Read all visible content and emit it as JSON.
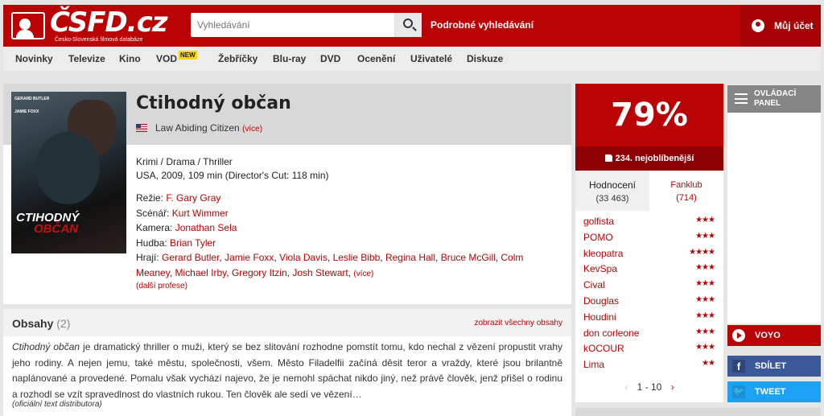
{
  "header": {
    "logo_text": "ČSFD.cz",
    "logo_subtitle": "Česko-Slovenská filmová databáze",
    "search_placeholder": "Vyhledávání",
    "advanced_search": "Podrobné vyhledávání",
    "account": "Můj účet",
    "brand_color": "#ba0305"
  },
  "nav": {
    "items": [
      "Novinky",
      "Televize",
      "Kino",
      "VOD",
      "Žebříčky",
      "Blu-ray",
      "DVD",
      "Ocenění",
      "Uživatelé",
      "Diskuze"
    ],
    "new_badge": "NEW"
  },
  "film": {
    "poster_names": [
      "GERARD BUTLER",
      "JAMIE FOXX"
    ],
    "poster_title_1": "CTIHODNÝ",
    "poster_title_2": "OBČAN",
    "title": "Ctihodný občan",
    "original_title": "Law Abiding Citizen",
    "original_more": "(více)",
    "genre": "Krimi / Drama / Thriller",
    "origin": "USA, 2009, 109 min (Director's Cut: 118 min)",
    "director_label": "Režie:",
    "director": "F. Gary Gray",
    "writer_label": "Scénář:",
    "writer": "Kurt Wimmer",
    "camera_label": "Kamera:",
    "camera": "Jonathan Sela",
    "music_label": "Hudba:",
    "music": "Brian Tyler",
    "cast_label": "Hrají:",
    "cast": [
      "Gerard Butler",
      "Jamie Foxx",
      "Viola Davis",
      "Leslie Bibb",
      "Regina Hall",
      "Bruce McGill",
      "Colm Meaney",
      "Michael Irby",
      "Gregory Itzin",
      "Josh Stewart"
    ],
    "cast_more": "(více)",
    "further": "(další profese)"
  },
  "plot": {
    "title": "Obsahy",
    "count": "(2)",
    "show_all": "zobrazit všechny obsahy",
    "lead": "Ctihodný občan",
    "text": " je dramatický thriller o muži, který se bez slitování rozhodne pomstít tomu, kdo nechal z vězení propustit vrahy jeho rodiny. A nejen jemu, také městu, společnosti, všem. Město Filadelfii začíná děsit teror a vraždy, které jsou brilantně naplánované a provedené. Pomalu však vychází najevo, že je nemohl spáchat nikdo jiný, než právě člověk, jenž přišel o rodinu a rozhodl se vzít spravedlnost do vlastních rukou. Ten člověk ale sedí ve vězení…",
    "source": "(oficiální text distributora)"
  },
  "rating": {
    "score": "79%",
    "score_value": 79,
    "rank": "234. nejoblíbenější",
    "tab_ratings": "Hodnocení",
    "ratings_count": "(33 463)",
    "tab_fanclub": "Fanklub",
    "fanclub_count": "(714)",
    "users": [
      {
        "name": "golfista",
        "stars": "★★★"
      },
      {
        "name": "POMO",
        "stars": "★★★"
      },
      {
        "name": "kleopatra",
        "stars": "★★★★"
      },
      {
        "name": "KevSpa",
        "stars": "★★★"
      },
      {
        "name": "Cival",
        "stars": "★★★"
      },
      {
        "name": "Douglas",
        "stars": "★★★"
      },
      {
        "name": "Houdini",
        "stars": "★★★"
      },
      {
        "name": "don corleone",
        "stars": "★★★"
      },
      {
        "name": "kOCOUR",
        "stars": "★★★"
      },
      {
        "name": "Lima",
        "stars": "★★"
      }
    ],
    "pager": "1 - 10",
    "prev": "‹",
    "next": "›"
  },
  "side": {
    "control_panel": "OVLÁDACÍ PANEL",
    "voyo": "VOYO",
    "share": "SDÍLET",
    "share_icon": "f",
    "tweet": "TWEET",
    "tweet_icon": "🐦"
  }
}
